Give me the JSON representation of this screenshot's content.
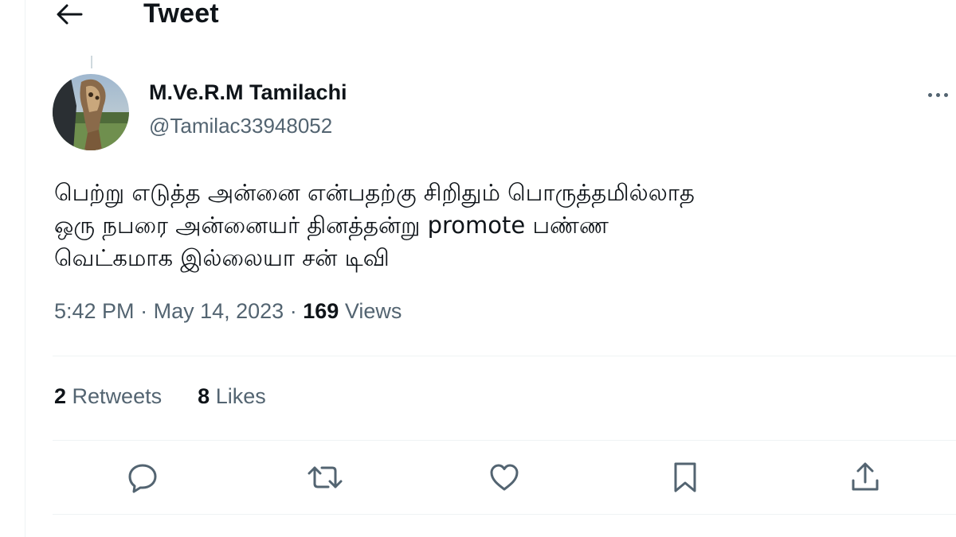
{
  "header": {
    "title": "Tweet",
    "back_icon": "arrow-left-icon"
  },
  "author": {
    "display_name": "M.Ve.R.M Tamilachi",
    "handle": "@Tamilac33948052",
    "avatar_icon": "user-avatar"
  },
  "tweet": {
    "lines": [
      "பெற்று எடுத்த அன்னை என்பதற்கு சிறிதும் பொருத்தமில்லாத",
      "ஒரு நபரை அன்னையர் தினத்தன்று promote பண்ண",
      "வெட்கமாக இல்லையா  சன் டிவி"
    ]
  },
  "meta": {
    "time": "5:42 PM",
    "separator": "·",
    "date": "May 14, 2023",
    "views_count": "169",
    "views_label": "Views"
  },
  "stats": {
    "retweets_count": "2",
    "retweets_label": "Retweets",
    "likes_count": "8",
    "likes_label": "Likes"
  },
  "actions": [
    {
      "icon": "reply-icon"
    },
    {
      "icon": "retweet-icon"
    },
    {
      "icon": "like-icon"
    },
    {
      "icon": "bookmark-icon"
    },
    {
      "icon": "share-icon"
    }
  ],
  "more_icon": "more-dots-icon",
  "colors": {
    "text_primary": "#0f1419",
    "text_secondary": "#536471",
    "divider": "#eff3f4"
  }
}
